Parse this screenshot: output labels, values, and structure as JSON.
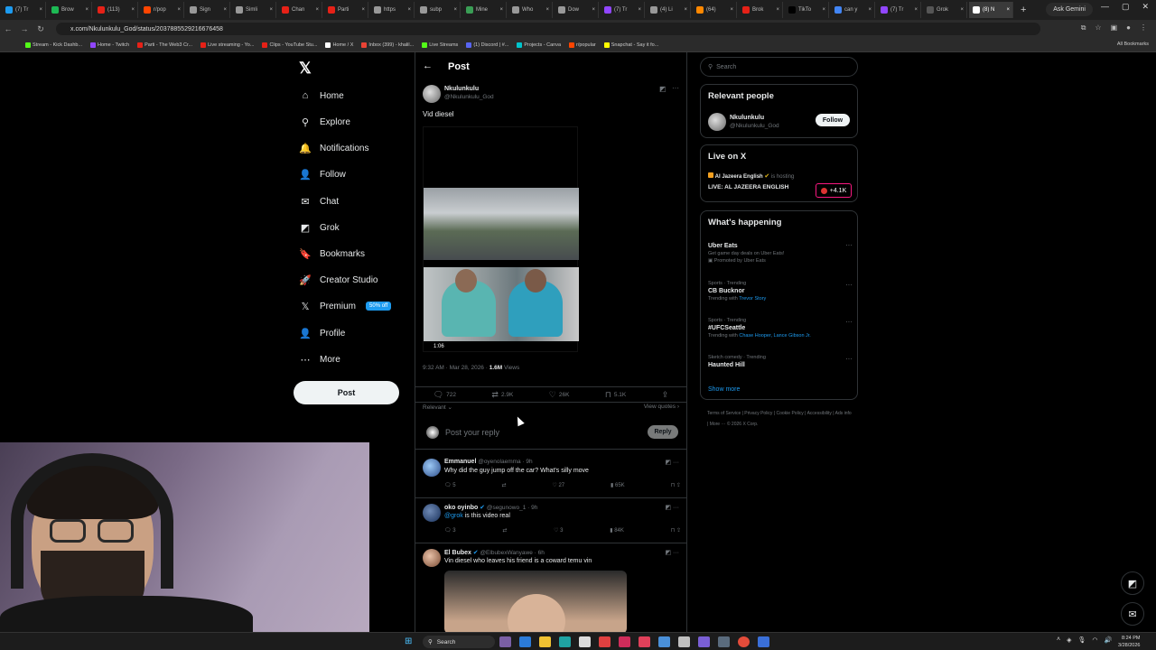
{
  "browser": {
    "tabs": [
      {
        "label": "(7) Tr",
        "color": "#1d9bf0"
      },
      {
        "label": "Brow",
        "color": "#1db954"
      },
      {
        "label": "(113)",
        "color": "#e62117"
      },
      {
        "label": "r/pop",
        "color": "#ff4500"
      },
      {
        "label": "Sign",
        "color": "#999999"
      },
      {
        "label": "Simli",
        "color": "#999999"
      },
      {
        "label": "Chan",
        "color": "#e62117"
      },
      {
        "label": "Parti",
        "color": "#e62117"
      },
      {
        "label": "https",
        "color": "#999999"
      },
      {
        "label": "subp",
        "color": "#999999"
      },
      {
        "label": "Mine",
        "color": "#3a9e55"
      },
      {
        "label": "Who",
        "color": "#999999"
      },
      {
        "label": "Dow",
        "color": "#999999"
      },
      {
        "label": "(7) Tr",
        "color": "#9146ff"
      },
      {
        "label": "(4) Li",
        "color": "#999999"
      },
      {
        "label": "(64)",
        "color": "#ff8800"
      },
      {
        "label": "Brok",
        "color": "#e62117"
      },
      {
        "label": "TikTo",
        "color": "#000000"
      },
      {
        "label": "can y",
        "color": "#4285f4"
      },
      {
        "label": "(7) Tr",
        "color": "#9146ff"
      },
      {
        "label": "Grok",
        "color": "#555555"
      },
      {
        "label": "(8) N",
        "color": "#ffffff"
      }
    ],
    "new_tab": "+",
    "gemini": "Ask Gemini",
    "url": "x.com/Nkulunkulu_God/status/2037885529216676458",
    "bookmarks": [
      {
        "label": "Stream - Kick Dashb...",
        "color": "#53fc18"
      },
      {
        "label": "Home - Twitch",
        "color": "#9146ff"
      },
      {
        "label": "Parti - The Web3 Cr...",
        "color": "#e62117"
      },
      {
        "label": "Live streaming - Yo...",
        "color": "#e62117"
      },
      {
        "label": "Clips - YouTube Stu...",
        "color": "#e62117"
      },
      {
        "label": "Home / X",
        "color": "#ffffff"
      },
      {
        "label": "Inbox (399) - khalil...",
        "color": "#ea4335"
      },
      {
        "label": "Live Streams",
        "color": "#53fc18"
      },
      {
        "label": "(1) Discord | #...",
        "color": "#5865f2"
      },
      {
        "label": "Projects - Canva",
        "color": "#00c4cc"
      },
      {
        "label": "r/popular",
        "color": "#ff4500"
      },
      {
        "label": "Snapchat - Say it fo...",
        "color": "#fffc00"
      }
    ],
    "all_bookmarks": "All Bookmarks"
  },
  "nav": {
    "items": [
      {
        "label": "Home",
        "icon": "home-icon",
        "glyph": "⌂"
      },
      {
        "label": "Explore",
        "icon": "search-icon",
        "glyph": "⚲"
      },
      {
        "label": "Notifications",
        "icon": "bell-icon",
        "glyph": "🔔"
      },
      {
        "label": "Follow",
        "icon": "follow-icon",
        "glyph": "👤"
      },
      {
        "label": "Chat",
        "icon": "mail-icon",
        "glyph": "✉"
      },
      {
        "label": "Grok",
        "icon": "grok-icon",
        "glyph": "◩"
      },
      {
        "label": "Bookmarks",
        "icon": "bookmark-icon",
        "glyph": "🔖"
      },
      {
        "label": "Creator Studio",
        "icon": "rocket-icon",
        "glyph": "🚀"
      },
      {
        "label": "Premium",
        "icon": "x-icon",
        "glyph": "𝕏",
        "badge": "50% off"
      },
      {
        "label": "Profile",
        "icon": "person-icon",
        "glyph": "👤"
      },
      {
        "label": "More",
        "icon": "more-icon",
        "glyph": "⋯"
      }
    ],
    "post_label": "Post",
    "more_dots": "···"
  },
  "post": {
    "header_title": "Post",
    "author_name": "Nkulunkulu",
    "author_handle": "@Nkulunkulu_God",
    "text": "Vid diesel",
    "duration": "1:06",
    "timestamp": "9:32 AM · Mar 28, 2026 ·",
    "views_count": "1.6M",
    "views_label": "Views",
    "replies": "722",
    "reposts": "2.9K",
    "likes": "26K",
    "bookmarks": "5.1K",
    "sort_label": "Relevant",
    "view_quotes": "View quotes",
    "reply_placeholder": "Post your reply",
    "reply_button": "Reply"
  },
  "replies": [
    {
      "name": "Emmanuel",
      "handle": "@oyenolaemma · 9h",
      "text": "Why did the guy jump off the car? What's silly move",
      "replies": "5",
      "reposts": "",
      "likes": "27",
      "views": "65K"
    },
    {
      "name": "oko oyinbo",
      "handle": "@segunowo_1 · 9h",
      "mention": "@grok",
      "text": " is this video real",
      "replies": "3",
      "reposts": "",
      "likes": "3",
      "views": "84K"
    },
    {
      "name": "El Bubex",
      "handle": "@ElbubexWanyawe · 6h",
      "text": "Vin diesel who leaves his friend is a coward temu vin"
    }
  ],
  "sidebar": {
    "search_placeholder": "Search",
    "relevant_title": "Relevant people",
    "relevant_name": "Nkulunkulu",
    "relevant_handle": "@Nkulunkulu_God",
    "follow_label": "Follow",
    "live_title": "Live on X",
    "live_host": "Al Jazeera English",
    "live_suffix": "is hosting",
    "live_name": "LIVE: AL JAZEERA ENGLISH",
    "live_count": "+4.1K",
    "happening_title": "What's happening",
    "trends": [
      {
        "cat": "",
        "title": "Uber Eats",
        "sub": "Get game day deals on Uber Eats!",
        "sub2": "Promoted by Uber Eats"
      },
      {
        "cat": "Sports · Trending",
        "title": "CB Bucknor",
        "sub": "Trending with",
        "link": "Trevor Story"
      },
      {
        "cat": "Sports · Trending",
        "title": "#UFCSeattle",
        "sub": "Trending with",
        "link": "Chase Hooper, Lance Gibson Jr."
      },
      {
        "cat": "Sketch comedy · Trending",
        "title": "Haunted Hill",
        "sub": ""
      }
    ],
    "show_more": "Show more",
    "footer": "Terms of Service | Privacy Policy | Cookie Policy | Accessibility | Ads info | More ··· © 2026 X Corp."
  },
  "taskbar": {
    "search": "Search",
    "time": "8:24 PM",
    "date": "3/28/2026"
  }
}
